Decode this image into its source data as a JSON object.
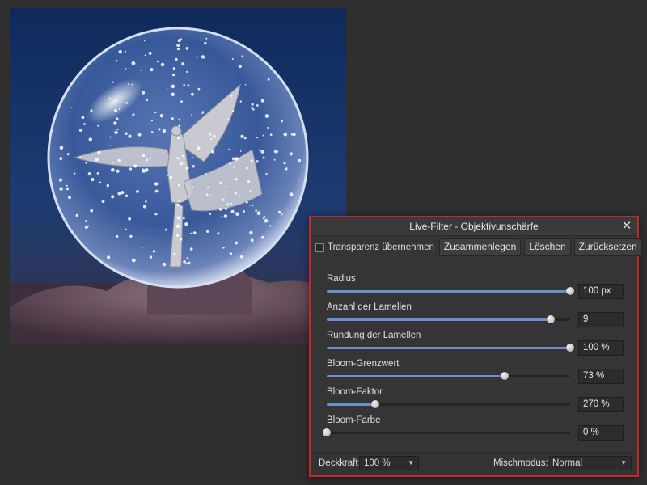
{
  "dialog": {
    "title": "Live-Filter - Objektivunschärfe",
    "close_glyph": "✕",
    "toolbar": {
      "transparency_label": "Transparenz übernehmen",
      "transparency_checked": false,
      "merge_label": "Zusammenlegen",
      "delete_label": "Löschen",
      "reset_label": "Zurücksetzen"
    },
    "params": [
      {
        "label": "Radius",
        "value": "100 px",
        "level": 1.0
      },
      {
        "label": "Anzahl der Lamellen",
        "value": "9",
        "level": 0.92
      },
      {
        "label": "Rundung der Lamellen",
        "value": "100 %",
        "level": 1.0
      },
      {
        "label": "Bloom-Grenzwert",
        "value": "73 %",
        "level": 0.73
      },
      {
        "label": "Bloom-Faktor",
        "value": "270 %",
        "level": 0.2
      },
      {
        "label": "Bloom-Farbe",
        "value": "0 %",
        "level": 0.0
      }
    ],
    "footer": {
      "opacity_label": "Deckkraft:",
      "opacity_value": "100 %",
      "blend_label": "Mischmodus:",
      "blend_value": "Normal",
      "caret_glyph": "▼"
    }
  },
  "colors": {
    "accent": "#6a8fcf",
    "dialog_border": "#c1272d",
    "background": "#2f2f2f"
  },
  "icons": {
    "close": "close-icon",
    "dropdown": "chevron-down-icon"
  }
}
